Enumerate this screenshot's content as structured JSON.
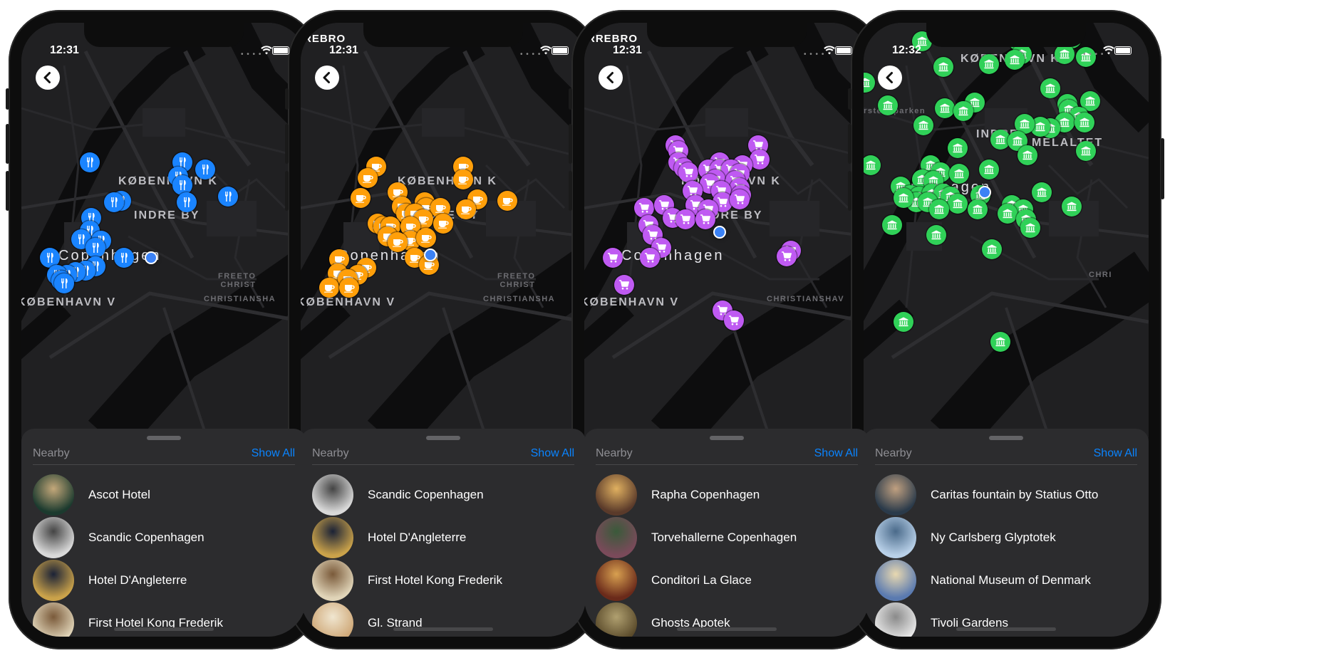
{
  "phones": [
    {
      "time": "12:31",
      "carrier": "",
      "accent": "#1a84ff",
      "category_icon": "fork-knife-icon",
      "map_labels": {
        "kbh_k": "KØBENHAVN K",
        "indre_by": "INDRE BY",
        "city": "Copenhagen",
        "kbh_v": "KØBENHAVN V",
        "freetown": "FREETO\nCHRIST",
        "christianshavn": "CHRISTIANSHA"
      },
      "sheet": {
        "title": "Nearby",
        "show_all": "Show All",
        "items": [
          "Ascot Hotel",
          "Scandic Copenhagen",
          "Hotel D'Angleterre",
          "First Hotel Kong Frederik"
        ]
      }
    },
    {
      "time": "12:31",
      "carrier": "REBRO",
      "accent": "#ff9f0a",
      "category_icon": "coffee-cup-icon",
      "map_labels": {
        "kbh_k": "KØBENHAVN K",
        "indre_by": "INDRE BY",
        "city": "Copenhagen",
        "kbh_v": "KØBENHAVN V",
        "freetown": "FREETO\nCHRIST",
        "christianshavn": "CHRISTIANSHA"
      },
      "sheet": {
        "title": "Nearby",
        "show_all": "Show All",
        "items": [
          "Scandic Copenhagen",
          "Hotel D'Angleterre",
          "First Hotel Kong Frederik",
          "Gl. Strand"
        ]
      }
    },
    {
      "time": "12:31",
      "carrier": "RREBRO",
      "accent": "#bf5af2",
      "category_icon": "shopping-cart-icon",
      "map_labels": {
        "kbh_k": "KØBENHAVN K",
        "indre_by": "INDRE BY",
        "city": "Copenhagen",
        "kbh_v": "KØBENHAVN V",
        "freetown": "",
        "christianshavn": "CHRISTIANSHAV"
      },
      "sheet": {
        "title": "Nearby",
        "show_all": "Show All",
        "items": [
          "Rapha Copenhagen",
          "Torvehallerne Copenhagen",
          "Conditori La Glace",
          "Ghosts Apotek"
        ]
      }
    },
    {
      "time": "12:32",
      "carrier": "",
      "accent": "#30d158",
      "category_icon": "museum-icon",
      "map_labels": {
        "kbh_k": "KØBENHAVN K",
        "indre_by": "INDRE",
        "city": "openhagen",
        "kbh_v": "",
        "freetown": "",
        "christianshavn": "CHRI",
        "park": "Ørstedsparken",
        "latin": "MELALTET"
      },
      "sheet": {
        "title": "Nearby",
        "show_all": "Show All",
        "items": [
          "Caritas fountain by Statius Otto",
          "Ny Carlsberg Glyptotek",
          "National Museum of Denmark",
          "Tivoli Gardens"
        ]
      }
    }
  ]
}
